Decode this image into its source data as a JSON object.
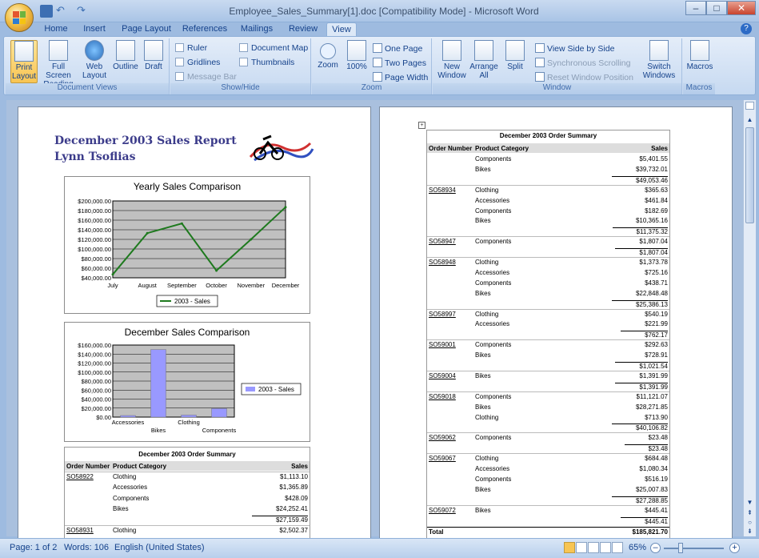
{
  "window": {
    "title": "Employee_Sales_Summary[1].doc [Compatibility Mode] - Microsoft Word"
  },
  "tabs": [
    "Home",
    "Insert",
    "Page Layout",
    "References",
    "Mailings",
    "Review",
    "View"
  ],
  "ribbon": {
    "doc_views": {
      "label": "Document Views",
      "buttons": [
        "Print Layout",
        "Full Screen Reading",
        "Web Layout",
        "Outline",
        "Draft"
      ]
    },
    "show_hide": {
      "label": "Show/Hide",
      "checks": [
        "Ruler",
        "Gridlines",
        "Message Bar",
        "Document Map",
        "Thumbnails"
      ]
    },
    "zoom": {
      "label": "Zoom",
      "buttons": [
        "Zoom",
        "100%"
      ],
      "small": [
        "One Page",
        "Two Pages",
        "Page Width"
      ]
    },
    "window": {
      "label": "Window",
      "buttons": [
        "New Window",
        "Arrange All",
        "Split"
      ],
      "small": [
        "View Side by Side",
        "Synchronous Scrolling",
        "Reset Window Position"
      ],
      "switch": "Switch Windows"
    },
    "macros": {
      "label": "Macros",
      "button": "Macros"
    }
  },
  "page1": {
    "title1": "December 2003 Sales Report",
    "title2": "Lynn Tsoflias",
    "table_title": "December 2003 Order Summary",
    "headers": [
      "Order Number",
      "Product Category",
      "Sales"
    ],
    "rows": [
      {
        "order": "SO58922",
        "cat": "Clothing",
        "sales": "$1,113.10"
      },
      {
        "order": "",
        "cat": "Accessories",
        "sales": "$1,365.89"
      },
      {
        "order": "",
        "cat": "Components",
        "sales": "$428.09"
      },
      {
        "order": "",
        "cat": "Bikes",
        "sales": "$24,252.41"
      },
      {
        "order": "",
        "cat": "",
        "sales": "$27,159.49"
      },
      {
        "order": "SO58931",
        "cat": "Clothing",
        "sales": "$2,502.37"
      }
    ]
  },
  "chart_data": [
    {
      "type": "line",
      "title": "Yearly Sales Comparison",
      "categories": [
        "July",
        "August",
        "September",
        "October",
        "November",
        "December"
      ],
      "series": [
        {
          "name": "2003 - Sales",
          "values": [
            47000,
            133000,
            153000,
            55000,
            120000,
            187000
          ]
        }
      ],
      "yticks": [
        "$200,000.00",
        "$180,000.00",
        "$160,000.00",
        "$140,000.00",
        "$120,000.00",
        "$100,000.00",
        "$80,000.00",
        "$60,000.00",
        "$40,000.00"
      ],
      "ylim": [
        40000,
        200000
      ],
      "legend": "bottom"
    },
    {
      "type": "bar",
      "title": "December Sales Comparison",
      "categories": [
        "Accessories",
        "Bikes",
        "Clothing",
        "Components"
      ],
      "series": [
        {
          "name": "2003 - Sales",
          "values": [
            3500,
            150000,
            4500,
            19000
          ]
        }
      ],
      "yticks": [
        "$160,000.00",
        "$140,000.00",
        "$120,000.00",
        "$100,000.00",
        "$80,000.00",
        "$60,000.00",
        "$40,000.00",
        "$20,000.00",
        "$0.00"
      ],
      "ylim": [
        0,
        160000
      ],
      "legend": "right"
    }
  ],
  "page2": {
    "table_title": "December 2003 Order Summary",
    "headers": [
      "Order Number",
      "Product Category",
      "Sales"
    ],
    "rows": [
      {
        "order": "",
        "cat": "Components",
        "sales": "$5,401.55"
      },
      {
        "order": "",
        "cat": "Bikes",
        "sales": "$39,732.01"
      },
      {
        "order": "",
        "cat": "",
        "sales": "$49,053.46",
        "sub": true
      },
      {
        "order": "SO58934",
        "cat": "Clothing",
        "sales": "$365.63"
      },
      {
        "order": "",
        "cat": "Accessories",
        "sales": "$461.84"
      },
      {
        "order": "",
        "cat": "Components",
        "sales": "$182.69"
      },
      {
        "order": "",
        "cat": "Bikes",
        "sales": "$10,365.16"
      },
      {
        "order": "",
        "cat": "",
        "sales": "$11,375.32",
        "sub": true
      },
      {
        "order": "SO58947",
        "cat": "Components",
        "sales": "$1,807.04"
      },
      {
        "order": "",
        "cat": "",
        "sales": "$1,807.04",
        "sub": true
      },
      {
        "order": "SO58948",
        "cat": "Clothing",
        "sales": "$1,373.78"
      },
      {
        "order": "",
        "cat": "Accessories",
        "sales": "$725.16"
      },
      {
        "order": "",
        "cat": "Components",
        "sales": "$438.71"
      },
      {
        "order": "",
        "cat": "Bikes",
        "sales": "$22,848.48"
      },
      {
        "order": "",
        "cat": "",
        "sales": "$25,386.13",
        "sub": true
      },
      {
        "order": "SO58997",
        "cat": "Clothing",
        "sales": "$540.19"
      },
      {
        "order": "",
        "cat": "Accessories",
        "sales": "$221.99"
      },
      {
        "order": "",
        "cat": "",
        "sales": "$762.17",
        "sub": true
      },
      {
        "order": "SO59001",
        "cat": "Components",
        "sales": "$292.63"
      },
      {
        "order": "",
        "cat": "Bikes",
        "sales": "$728.91"
      },
      {
        "order": "",
        "cat": "",
        "sales": "$1,021.54",
        "sub": true
      },
      {
        "order": "SO59004",
        "cat": "Bikes",
        "sales": "$1,391.99"
      },
      {
        "order": "",
        "cat": "",
        "sales": "$1,391.99",
        "sub": true
      },
      {
        "order": "SO59018",
        "cat": "Components",
        "sales": "$11,121.07"
      },
      {
        "order": "",
        "cat": "Bikes",
        "sales": "$28,271.85"
      },
      {
        "order": "",
        "cat": "Clothing",
        "sales": "$713.90"
      },
      {
        "order": "",
        "cat": "",
        "sales": "$40,106.82",
        "sub": true
      },
      {
        "order": "SO59062",
        "cat": "Components",
        "sales": "$23.48"
      },
      {
        "order": "",
        "cat": "",
        "sales": "$23.48",
        "sub": true
      },
      {
        "order": "SO59067",
        "cat": "Clothing",
        "sales": "$684.48"
      },
      {
        "order": "",
        "cat": "Accessories",
        "sales": "$1,080.34"
      },
      {
        "order": "",
        "cat": "Components",
        "sales": "$516.19"
      },
      {
        "order": "",
        "cat": "Bikes",
        "sales": "$25,007.83"
      },
      {
        "order": "",
        "cat": "",
        "sales": "$27,288.85",
        "sub": true
      },
      {
        "order": "SO59072",
        "cat": "Bikes",
        "sales": "$445.41"
      },
      {
        "order": "",
        "cat": "",
        "sales": "$445.41",
        "sub": true
      }
    ],
    "total_label": "Total",
    "total": "$185,821.70"
  },
  "status": {
    "page": "Page: 1 of 2",
    "words": "Words: 106",
    "lang": "English (United States)",
    "zoom": "65%"
  }
}
